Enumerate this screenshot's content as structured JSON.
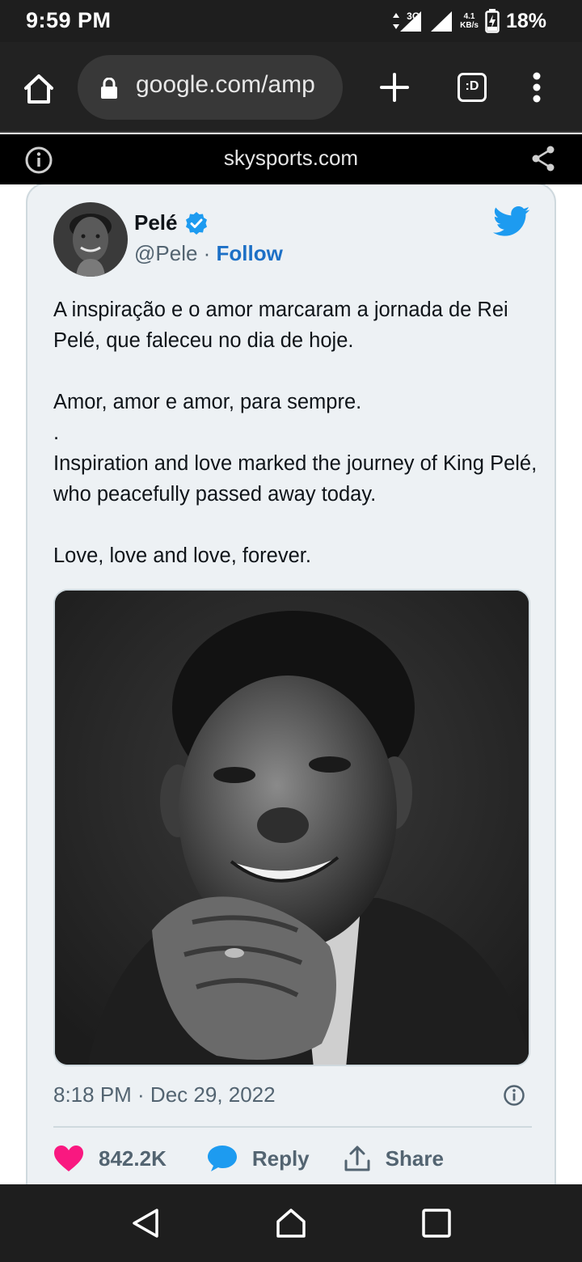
{
  "status_bar": {
    "time": "9:59 PM",
    "network": "3G",
    "speed_value": "4.1",
    "speed_unit": "KB/s",
    "battery": "18%"
  },
  "browser": {
    "url": "google.com/amp",
    "tabs_label": ":D"
  },
  "amp_header": {
    "domain": "skysports.com"
  },
  "tweet": {
    "author_name": "Pelé",
    "handle": "@Pele",
    "separator": " · ",
    "follow_label": "Follow",
    "text": "A inspiração e o amor marcaram a jornada de Rei Pelé, que faleceu no dia de hoje.\n\nAmor, amor e amor, para sempre.\n.\nInspiration and love marked the journey of King Pelé, who peacefully passed away today.\n\nLove, love and love, forever.",
    "timestamp": "8:18 PM · Dec 29, 2022",
    "likes": "842.2K",
    "reply_label": "Reply",
    "share_label": "Share"
  },
  "colors": {
    "follow": "#1d70c6",
    "twitter_blue": "#1d9bf0",
    "like": "#f91880",
    "card_bg": "#edf1f4"
  }
}
